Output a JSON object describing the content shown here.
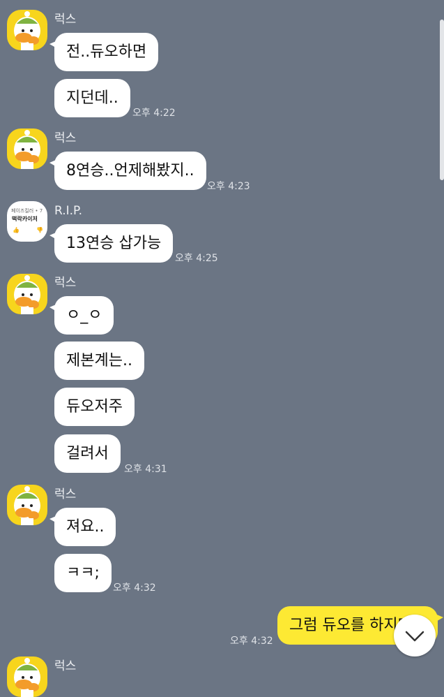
{
  "messages": {
    "g1": {
      "sender": "럭스",
      "texts": [
        "전..듀오하면",
        "지던데.."
      ],
      "time": "오후 4:22"
    },
    "g2": {
      "sender": "럭스",
      "texts": [
        "8연승..언제해봤지.."
      ],
      "time": "오후 4:23"
    },
    "g3": {
      "sender": "R.I.P.",
      "texts": [
        "13연승 삽가능"
      ],
      "time": "오후 4:25",
      "avatar_text": {
        "top": "페이즈킬러 • 7",
        "title": "떡락카이저",
        "left": "👍",
        "right": "👎"
      }
    },
    "g4": {
      "sender": "럭스",
      "texts": [
        "ㅇ_ㅇ",
        "제본계는..",
        "듀오저주",
        "걸려서"
      ],
      "time": "오후 4:31"
    },
    "g5": {
      "sender": "럭스",
      "texts": [
        "져요..",
        "ㅋㅋ;"
      ],
      "time": "오후 4:32"
    },
    "g6": {
      "texts": [
        "그럼 듀오를 하지마셈"
      ],
      "time": "오후 4:32"
    },
    "g7": {
      "sender": "럭스"
    }
  },
  "icons": {
    "avatar": "duck-character-icon",
    "scroll_down": "chevron-down-icon"
  },
  "colors": {
    "background": "#6b7584",
    "my_bubble": "#fde933",
    "other_bubble": "#ffffff"
  }
}
